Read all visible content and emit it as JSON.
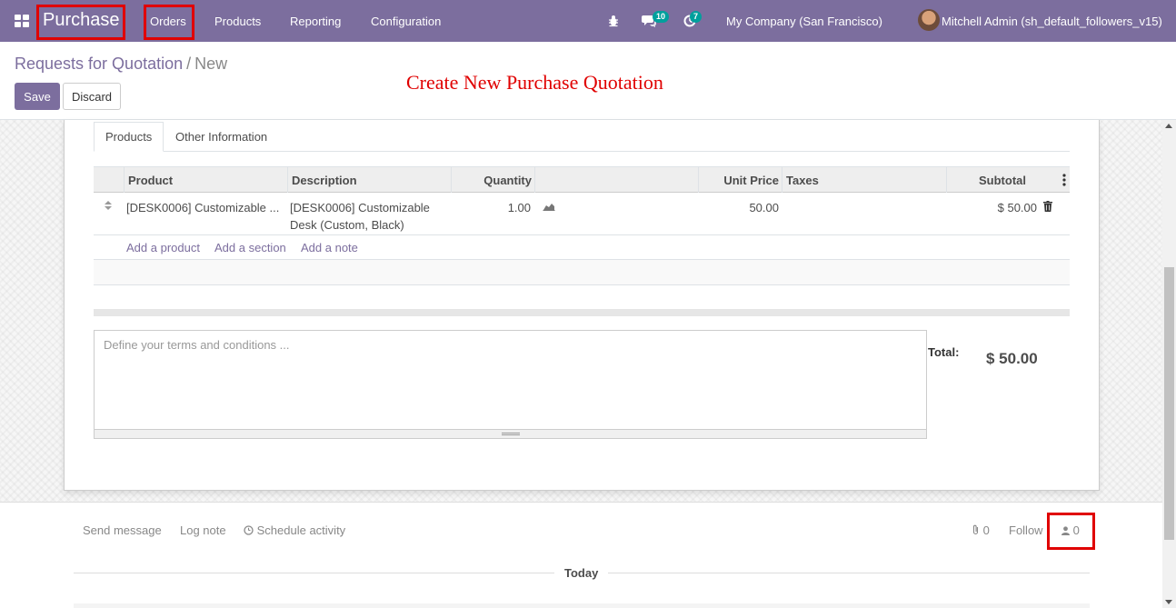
{
  "navbar": {
    "app_name": "Purchase",
    "menu": [
      "Orders",
      "Products",
      "Reporting",
      "Configuration"
    ],
    "messages_badge": "10",
    "activities_badge": "7",
    "company": "My Company (San Francisco)",
    "user": "Mitchell Admin (sh_default_followers_v15)"
  },
  "breadcrumb": {
    "parent": "Requests for Quotation",
    "separator": "/",
    "current": "New"
  },
  "buttons": {
    "save": "Save",
    "discard": "Discard"
  },
  "annotation": "Create New Purchase Quotation",
  "tabs": [
    "Products",
    "Other Information"
  ],
  "table": {
    "headers": [
      "Product",
      "Description",
      "Quantity",
      "",
      "Unit Price",
      "Taxes",
      "Subtotal"
    ],
    "rows": [
      {
        "product": "[DESK0006] Customizable ...",
        "description_line1": "[DESK0006] Customizable",
        "description_line2": "Desk (Custom, Black)",
        "quantity": "1.00",
        "unit_price": "50.00",
        "subtotal": "$ 50.00"
      }
    ],
    "add_links": [
      "Add a product",
      "Add a section",
      "Add a note"
    ]
  },
  "terms_placeholder": "Define your terms and conditions ...",
  "total": {
    "label": "Total:",
    "value": "$ 50.00"
  },
  "chatter": {
    "send_message": "Send message",
    "log_note": "Log note",
    "schedule_activity": "Schedule activity",
    "attachments_count": "0",
    "follow": "Follow",
    "followers_count": "0",
    "today": "Today"
  },
  "colors": {
    "brand": "#7c6e9e",
    "highlight": "#e00000",
    "badge": "#00a09d"
  }
}
